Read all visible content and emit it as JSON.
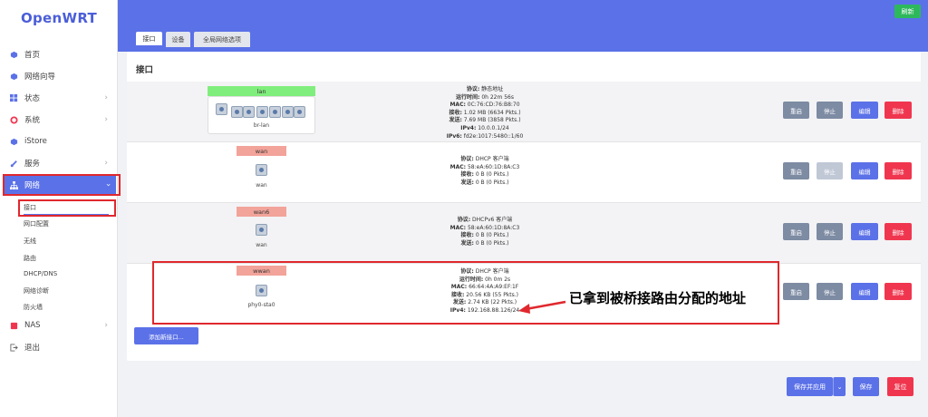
{
  "app": {
    "logo": "OpenWRT"
  },
  "sidebar": {
    "items": [
      {
        "label": "首页",
        "icon": "home-icon"
      },
      {
        "label": "网络向导",
        "icon": "wizard-icon"
      },
      {
        "label": "状态",
        "icon": "status-icon"
      },
      {
        "label": "系统",
        "icon": "system-icon"
      },
      {
        "label": "iStore",
        "icon": "store-icon"
      },
      {
        "label": "服务",
        "icon": "services-icon"
      },
      {
        "label": "网络",
        "icon": "network-icon"
      },
      {
        "label": "NAS",
        "icon": "nas-icon"
      },
      {
        "label": "退出",
        "icon": "logout-icon"
      }
    ],
    "network_sub": [
      "接口",
      "网口配置",
      "无线",
      "路由",
      "DHCP/DNS",
      "网络诊断",
      "防火墙"
    ]
  },
  "header": {
    "refresh_label": "刷新",
    "tabs": [
      "接口",
      "设备",
      "全局网络选项"
    ]
  },
  "main": {
    "title": "接口",
    "interfaces": [
      {
        "name": "lan",
        "device": "br-lan",
        "lines": [
          [
            "协议:",
            " 静态地址"
          ],
          [
            "运行时间:",
            " 0h 22m 56s"
          ],
          [
            "MAC:",
            " 0C:76:CD:76:B8:70"
          ],
          [
            "接收:",
            " 1.02 MB (6634 Pkts.)"
          ],
          [
            "发送:",
            " 7.69 MB (3858 Pkts.)"
          ],
          [
            "IPv4:",
            " 10.0.0.1/24"
          ],
          [
            "IPv6:",
            " fd2e:1017:5480::1/60"
          ]
        ]
      },
      {
        "name": "wan",
        "device": "wan",
        "lines": [
          [
            "协议:",
            " DHCP 客户端"
          ],
          [
            "MAC:",
            " 58:eA:60:1D:8A:C3"
          ],
          [
            "接收:",
            " 0 B (0 Pkts.)"
          ],
          [
            "发送:",
            " 0 B (0 Pkts.)"
          ]
        ]
      },
      {
        "name": "wan6",
        "device": "wan",
        "lines": [
          [
            "协议:",
            " DHCPv6 客户端"
          ],
          [
            "MAC:",
            " 58:eA:60:1D:8A:C3"
          ],
          [
            "接收:",
            " 0 B (0 Pkts.)"
          ],
          [
            "发送:",
            " 0 B (0 Pkts.)"
          ]
        ]
      },
      {
        "name": "wwan",
        "device": "phy0-sta0",
        "lines": [
          [
            "协议:",
            " DHCP 客户端"
          ],
          [
            "运行时间:",
            " 0h 0m 2s"
          ],
          [
            "MAC:",
            " 66:64:4A:A9:EF:1F"
          ],
          [
            "接收:",
            " 20.56 KB (55 Pkts.)"
          ],
          [
            "发送:",
            " 2.74 KB (22 Pkts.)"
          ],
          [
            "IPv4:",
            " 192.168.88.126/24"
          ]
        ]
      }
    ],
    "actions": {
      "restart": "重启",
      "stop": "停止",
      "edit": "编辑",
      "delete": "删除"
    },
    "add_interface": "添加新接口..."
  },
  "annotation": "已拿到被桥接路由分配的地址",
  "footer": {
    "save_apply": "保存并应用",
    "save": "保存",
    "reset": "复位"
  },
  "colors": {
    "accent": "#5b71e8",
    "danger": "#f0364f",
    "success": "#2eb85c",
    "annotation_red": "#e0282e"
  }
}
